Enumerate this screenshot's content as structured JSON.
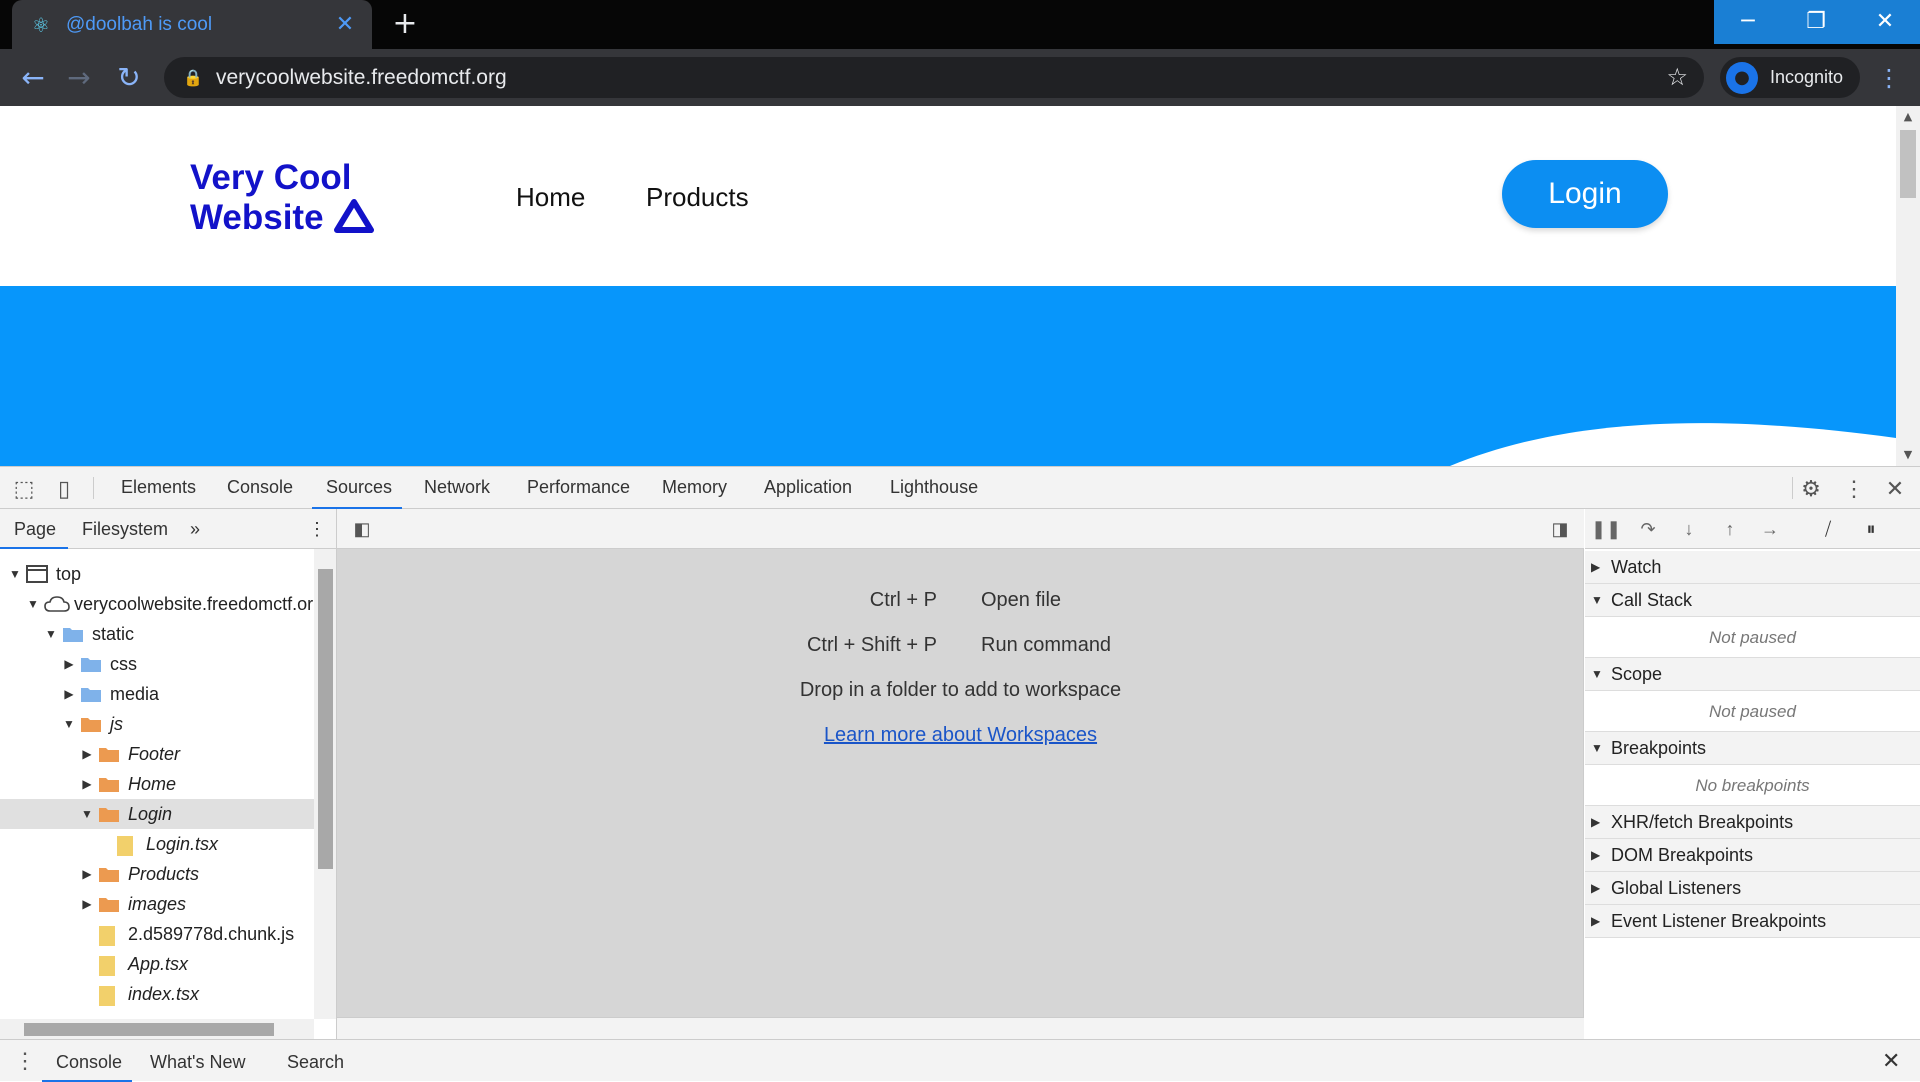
{
  "browser": {
    "tab_title": "@doolbah is cool",
    "url": "verycoolwebsite.freedomctf.org",
    "profile_label": "Incognito",
    "window_controls": [
      "minimize-icon",
      "restore-icon",
      "close-icon"
    ]
  },
  "site": {
    "logo_line1": "Very Cool",
    "logo_line2": "Website",
    "nav": [
      "Home",
      "Products"
    ],
    "login_label": "Login",
    "brand_color": "#1212c9",
    "accent_color": "#0796fb"
  },
  "devtools": {
    "tabs": [
      "Elements",
      "Console",
      "Sources",
      "Network",
      "Performance",
      "Memory",
      "Application",
      "Lighthouse"
    ],
    "active_tab": "Sources",
    "navigator_tabs": [
      "Page",
      "Filesystem"
    ],
    "tree": [
      {
        "label": "top",
        "type": "frame",
        "expanded": true,
        "depth": 0
      },
      {
        "label": "verycoolwebsite.freedomctf.or",
        "type": "cloud",
        "expanded": true,
        "depth": 1
      },
      {
        "label": "static",
        "type": "folder-blue",
        "expanded": true,
        "depth": 2
      },
      {
        "label": "css",
        "type": "folder-blue",
        "expanded": false,
        "depth": 3
      },
      {
        "label": "media",
        "type": "folder-blue",
        "expanded": false,
        "depth": 3
      },
      {
        "label": "js",
        "type": "folder-orange",
        "expanded": true,
        "depth": 3,
        "italic": true
      },
      {
        "label": "Footer",
        "type": "folder-orange",
        "expanded": false,
        "depth": 4,
        "italic": true
      },
      {
        "label": "Home",
        "type": "folder-orange",
        "expanded": false,
        "depth": 4,
        "italic": true
      },
      {
        "label": "Login",
        "type": "folder-orange",
        "expanded": true,
        "depth": 4,
        "italic": true,
        "selected": true
      },
      {
        "label": "Login.tsx",
        "type": "file",
        "depth": 5,
        "italic": true
      },
      {
        "label": "Products",
        "type": "folder-orange",
        "expanded": false,
        "depth": 4,
        "italic": true
      },
      {
        "label": "images",
        "type": "folder-orange",
        "expanded": false,
        "depth": 4,
        "italic": true
      },
      {
        "label": "2.d589778d.chunk.js",
        "type": "file",
        "depth": 4
      },
      {
        "label": "App.tsx",
        "type": "file",
        "depth": 4,
        "italic": true
      },
      {
        "label": "index.tsx",
        "type": "file",
        "depth": 4,
        "italic": true
      }
    ],
    "shortcuts": [
      {
        "keys": "Ctrl + P",
        "action": "Open file"
      },
      {
        "keys": "Ctrl + Shift + P",
        "action": "Run command"
      }
    ],
    "drop_text": "Drop in a folder to add to workspace",
    "learn_link": "Learn more about Workspaces",
    "debug_sections": [
      {
        "title": "Watch",
        "expanded": false
      },
      {
        "title": "Call Stack",
        "expanded": true,
        "body": "Not paused"
      },
      {
        "title": "Scope",
        "expanded": true,
        "body": "Not paused"
      },
      {
        "title": "Breakpoints",
        "expanded": true,
        "body": "No breakpoints"
      },
      {
        "title": "XHR/fetch Breakpoints",
        "expanded": false
      },
      {
        "title": "DOM Breakpoints",
        "expanded": false
      },
      {
        "title": "Global Listeners",
        "expanded": false
      },
      {
        "title": "Event Listener Breakpoints",
        "expanded": false
      }
    ],
    "drawer_tabs": [
      "Console",
      "What's New",
      "Search"
    ]
  }
}
